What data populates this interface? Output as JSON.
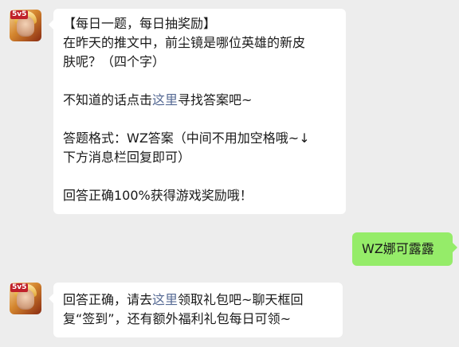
{
  "messages": [
    {
      "side": "left",
      "lines": [
        [
          "【每日一题，每日抽奖励】"
        ],
        [
          "在昨天的推文中，前尘镜是哪位英雄的新皮"
        ],
        [
          "肤呢？（四个字）"
        ],
        [],
        [
          "不知道的话点击",
          {
            "link": "这里"
          },
          "寻找答案吧~"
        ],
        [],
        [
          "答题格式：WZ答案（中间不用加空格哦~↓"
        ],
        [
          "下方消息栏回复即可）"
        ],
        [],
        [
          "回答正确100%获得游戏奖励哦！"
        ]
      ]
    },
    {
      "side": "right",
      "text": "WZ娜可露露"
    },
    {
      "side": "left",
      "lines": [
        [
          "回答正确，请去",
          {
            "link": "这里"
          },
          "领取礼包吧~聊天框回"
        ],
        [
          "复“签到”，还有额外福利礼包每日可领~"
        ]
      ]
    }
  ],
  "avatar_badge": "5v5"
}
